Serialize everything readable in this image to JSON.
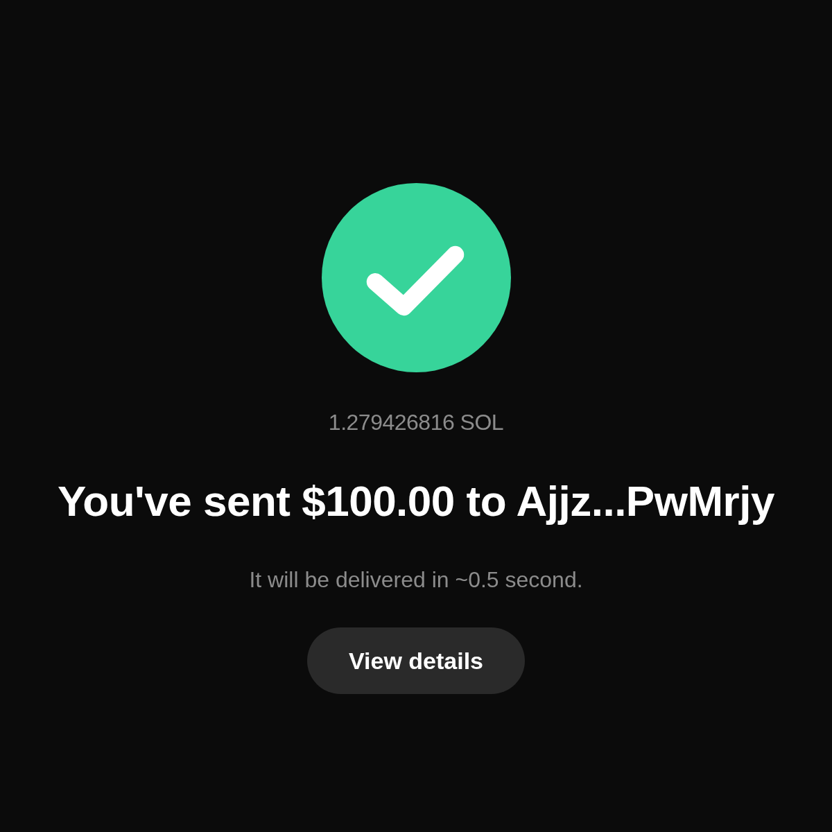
{
  "amount": "1.279426816 SOL",
  "heading": "You've sent $100.00 to Ajjz...PwMrjy",
  "subtitle": "It will be delivered in ~0.5 second.",
  "button": {
    "label": "View details"
  }
}
